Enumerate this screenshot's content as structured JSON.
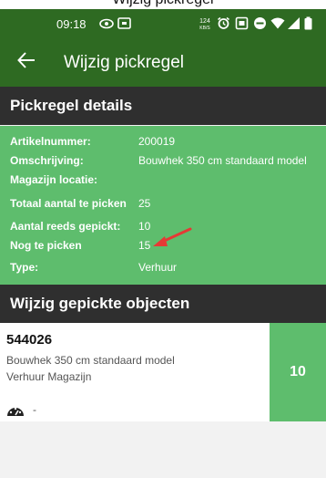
{
  "top_partial_text": "Wijzig pickregel",
  "status_bar": {
    "time": "09:18",
    "icons": [
      "eye-icon",
      "screen-record-icon",
      "data-speed-icon",
      "alarm-icon",
      "nfc-icon",
      "do-not-disturb-icon",
      "wifi-icon",
      "signal-icon",
      "battery-icon"
    ]
  },
  "app_bar": {
    "back_icon": "arrow-left-icon",
    "title": "Wijzig pickregel"
  },
  "details_section": {
    "heading": "Pickregel details",
    "rows": [
      {
        "label": "Artikelnummer:",
        "value": "200019"
      },
      {
        "label": "Omschrijving:",
        "value": "Bouwhek 350 cm standaard model"
      },
      {
        "label": "Magazijn locatie:",
        "value": ""
      },
      {
        "label": "Totaal aantal te picken",
        "value": "25"
      },
      {
        "label": "Aantal reeds gepickt:",
        "value": "10"
      },
      {
        "label": "Nog te picken",
        "value": "15"
      },
      {
        "label": "Type:",
        "value": "Verhuur"
      }
    ]
  },
  "objects_section": {
    "heading": "Wijzig gepickte objecten",
    "items": [
      {
        "code": "544026",
        "description": "Bouwhek 350 cm standaard model",
        "location": "Verhuur Magazijn",
        "meter_icon": "gauge-icon",
        "meter_value": "-",
        "quantity": "10"
      }
    ]
  },
  "colors": {
    "app_bar": "#2e6a22",
    "section_header": "#2f2f2f",
    "details_bg": "#5ebd6d",
    "annotation_arrow": "#e53935"
  }
}
